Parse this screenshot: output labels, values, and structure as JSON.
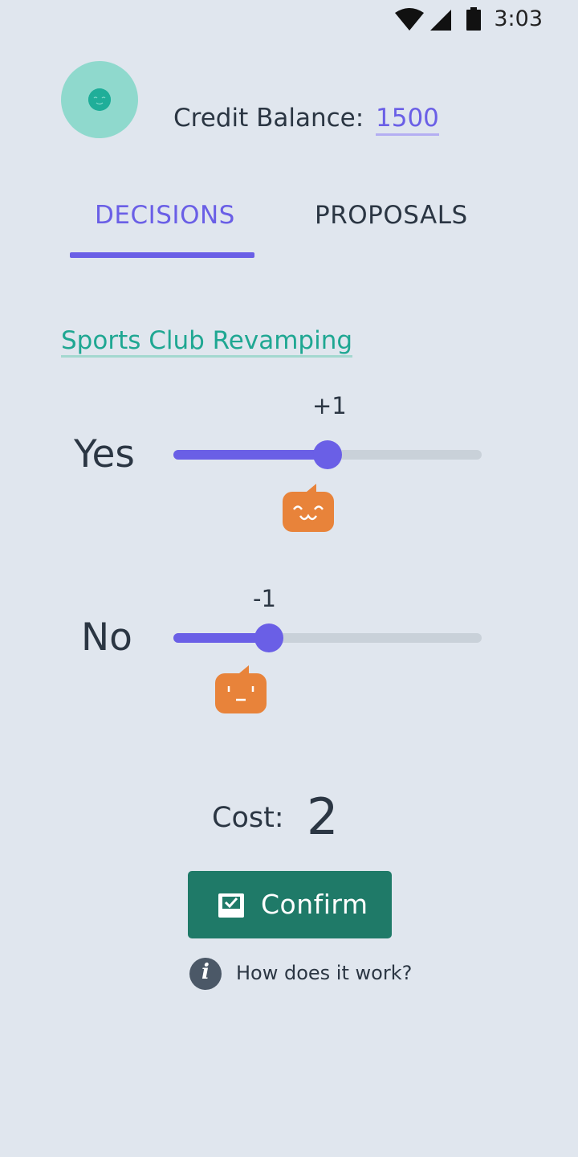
{
  "status_bar": {
    "time": "3:03"
  },
  "header": {
    "credit_label": "Credit Balance:",
    "credit_value": "1500"
  },
  "tabs": [
    {
      "label": "DECISIONS",
      "active": true
    },
    {
      "label": "PROPOSALS",
      "active": false
    }
  ],
  "proposal": {
    "title": "Sports Club Revamping",
    "options": [
      {
        "label": "Yes",
        "vote_value": "+1",
        "slider_fraction": 0.5
      },
      {
        "label": "No",
        "vote_value": "-1",
        "slider_fraction": 0.31
      }
    ]
  },
  "cost": {
    "label": "Cost:",
    "value": "2"
  },
  "actions": {
    "confirm_label": "Confirm",
    "help_label": "How does it work?"
  },
  "colors": {
    "accent": "#6a5fe6",
    "teal": "#1fa792",
    "confirm_bg": "#1f7a68",
    "mascot": "#e8833a",
    "background": "#e0e6ee"
  }
}
